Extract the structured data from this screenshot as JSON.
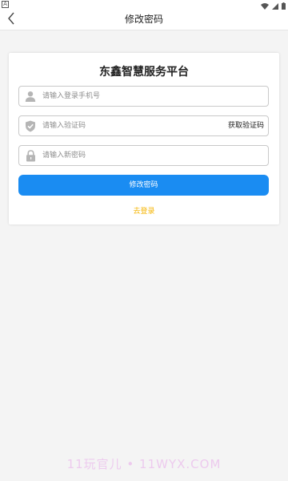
{
  "status_bar": {
    "left_icon_glyph": "A",
    "icons": [
      "wifi-icon",
      "signal-icon",
      "battery-icon"
    ]
  },
  "nav": {
    "title": "修改密码",
    "back_icon": "chevron-left-icon"
  },
  "form": {
    "title": "东鑫智慧服务平台",
    "phone": {
      "icon": "user-icon",
      "placeholder": "请输入登录手机号",
      "value": ""
    },
    "code": {
      "icon": "shield-icon",
      "placeholder": "请输入验证码",
      "value": "",
      "get_code_label": "获取验证码"
    },
    "password": {
      "icon": "lock-icon",
      "placeholder": "请输入新密码",
      "value": ""
    },
    "submit_label": "修改密码",
    "login_label": "去登录"
  },
  "watermark": "11玩官儿 • 11WYX.COM",
  "colors": {
    "primary": "#1a8cf2",
    "link": "#f5b400",
    "background": "#f4f4f4"
  }
}
